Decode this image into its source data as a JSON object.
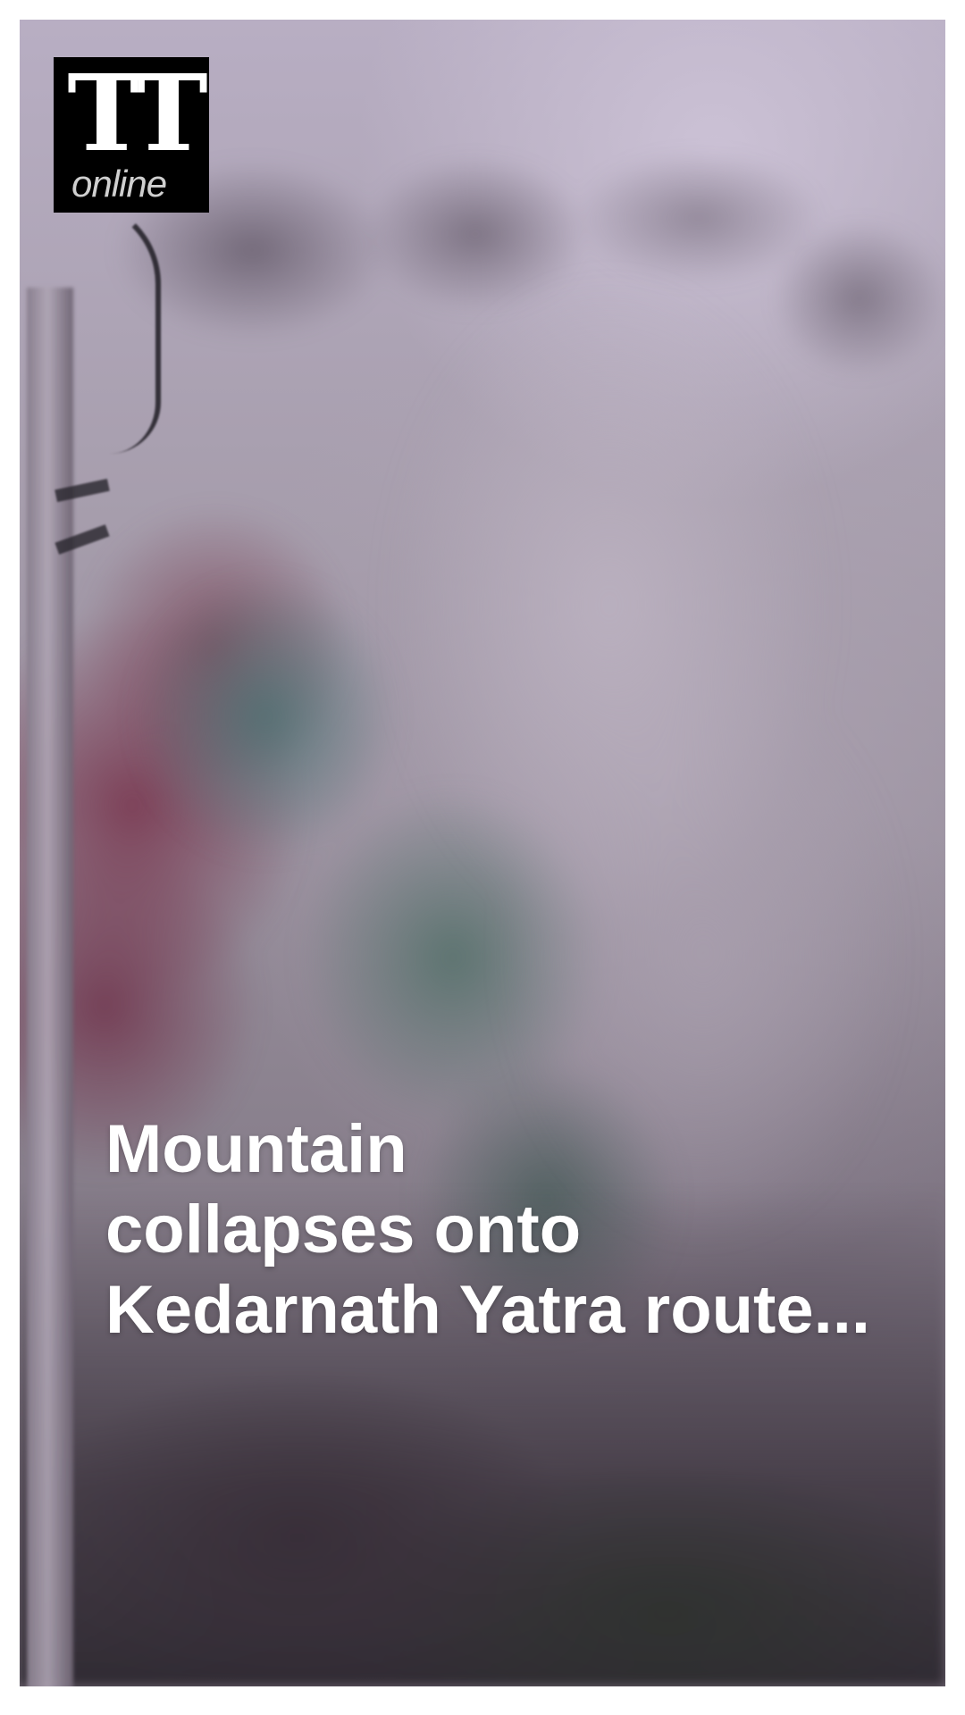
{
  "logo": {
    "mark": "TT",
    "sub": "online"
  },
  "headline": {
    "lines": [
      "Mountain",
      "collapses onto",
      "Kedarnath Yatra route..."
    ]
  },
  "colors": {
    "frame_border": "#ffffff",
    "logo_background": "#000000",
    "headline_text": "#ffffff"
  }
}
